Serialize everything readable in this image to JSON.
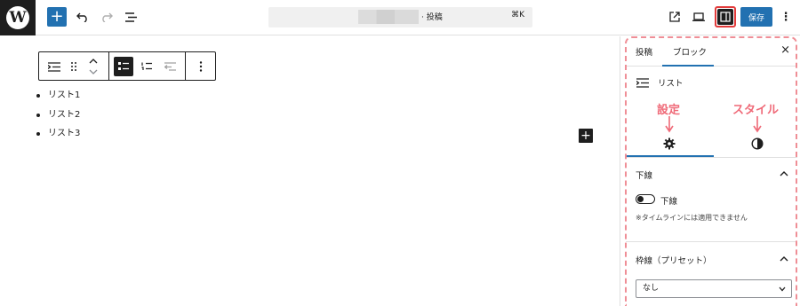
{
  "topbar": {
    "logo": "W",
    "inserter_label": "+",
    "doc_title": "· 投稿",
    "shortcut": "⌘K",
    "save_label": "保存",
    "more_label": "⋮"
  },
  "block_toolbar": {
    "items": [
      "block-type",
      "drag-handle",
      "move",
      "unordered-list",
      "ordered-list",
      "outdent",
      "options"
    ]
  },
  "content": {
    "list_items": [
      "リスト1",
      "リスト2",
      "リスト3"
    ],
    "add_block": "+"
  },
  "sidebar": {
    "tabs": [
      "投稿",
      "ブロック"
    ],
    "active_tab": "ブロック",
    "close": "×",
    "block_name": "リスト",
    "annotations": {
      "settings": "設定",
      "styles": "スタイル"
    },
    "sections": {
      "underline_title": "下線",
      "underline_toggle_label": "下線",
      "underline_note": "※タイムラインには適用できません",
      "border_title": "枠線（プリセット）",
      "border_select_value": "なし"
    }
  },
  "colors": {
    "accent": "#2271b1",
    "annotation": "#ef6a78",
    "highlight_border": "#e23b3b"
  }
}
